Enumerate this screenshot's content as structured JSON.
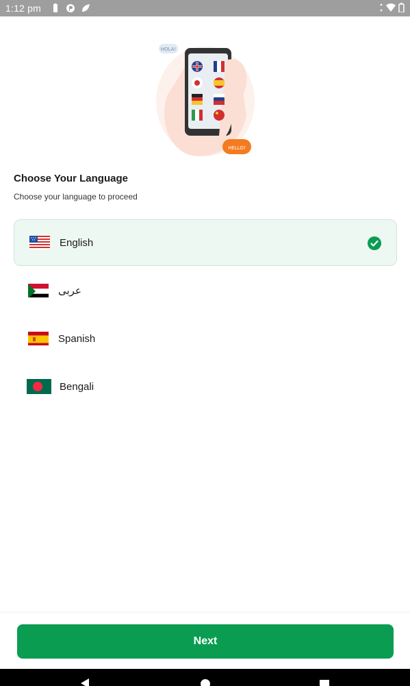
{
  "status_bar": {
    "time": "1:12 pm",
    "icons": [
      "battery-saver-icon",
      "data-saver-icon",
      "leaf-icon"
    ],
    "right_icons": [
      "data-arrows-icon",
      "wifi-icon",
      "battery-icon"
    ]
  },
  "illustration": {
    "bubble_left": "HOLA!",
    "bubble_right": "HELLO!"
  },
  "header": {
    "title": "Choose Your Language",
    "subtitle": "Choose your language to proceed"
  },
  "languages": [
    {
      "label": "English",
      "flag": "us-flag-icon",
      "selected": true
    },
    {
      "label": "عربى",
      "flag": "sudan-flag-icon",
      "selected": false
    },
    {
      "label": "Spanish",
      "flag": "spain-flag-icon",
      "selected": false
    },
    {
      "label": "Bengali",
      "flag": "bangladesh-flag-icon",
      "selected": false
    }
  ],
  "footer": {
    "next_label": "Next"
  },
  "colors": {
    "accent": "#0a9d52",
    "selected_bg": "#eef8f2",
    "status_bar": "#9e9e9e"
  },
  "nav_bar": {
    "buttons": [
      "back-icon",
      "home-icon",
      "recents-icon"
    ]
  }
}
